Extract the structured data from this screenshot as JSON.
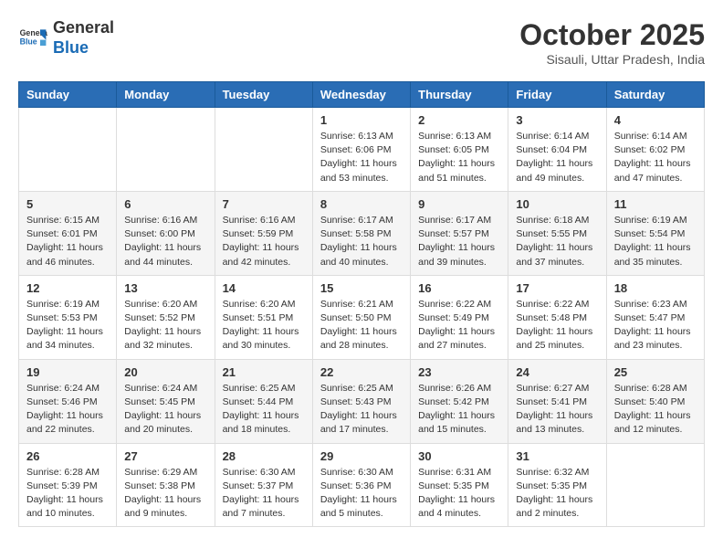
{
  "header": {
    "logo_general": "General",
    "logo_blue": "Blue",
    "month": "October 2025",
    "location": "Sisauli, Uttar Pradesh, India"
  },
  "weekdays": [
    "Sunday",
    "Monday",
    "Tuesday",
    "Wednesday",
    "Thursday",
    "Friday",
    "Saturday"
  ],
  "weeks": [
    [
      {
        "day": "",
        "info": ""
      },
      {
        "day": "",
        "info": ""
      },
      {
        "day": "",
        "info": ""
      },
      {
        "day": "1",
        "info": "Sunrise: 6:13 AM\nSunset: 6:06 PM\nDaylight: 11 hours\nand 53 minutes."
      },
      {
        "day": "2",
        "info": "Sunrise: 6:13 AM\nSunset: 6:05 PM\nDaylight: 11 hours\nand 51 minutes."
      },
      {
        "day": "3",
        "info": "Sunrise: 6:14 AM\nSunset: 6:04 PM\nDaylight: 11 hours\nand 49 minutes."
      },
      {
        "day": "4",
        "info": "Sunrise: 6:14 AM\nSunset: 6:02 PM\nDaylight: 11 hours\nand 47 minutes."
      }
    ],
    [
      {
        "day": "5",
        "info": "Sunrise: 6:15 AM\nSunset: 6:01 PM\nDaylight: 11 hours\nand 46 minutes."
      },
      {
        "day": "6",
        "info": "Sunrise: 6:16 AM\nSunset: 6:00 PM\nDaylight: 11 hours\nand 44 minutes."
      },
      {
        "day": "7",
        "info": "Sunrise: 6:16 AM\nSunset: 5:59 PM\nDaylight: 11 hours\nand 42 minutes."
      },
      {
        "day": "8",
        "info": "Sunrise: 6:17 AM\nSunset: 5:58 PM\nDaylight: 11 hours\nand 40 minutes."
      },
      {
        "day": "9",
        "info": "Sunrise: 6:17 AM\nSunset: 5:57 PM\nDaylight: 11 hours\nand 39 minutes."
      },
      {
        "day": "10",
        "info": "Sunrise: 6:18 AM\nSunset: 5:55 PM\nDaylight: 11 hours\nand 37 minutes."
      },
      {
        "day": "11",
        "info": "Sunrise: 6:19 AM\nSunset: 5:54 PM\nDaylight: 11 hours\nand 35 minutes."
      }
    ],
    [
      {
        "day": "12",
        "info": "Sunrise: 6:19 AM\nSunset: 5:53 PM\nDaylight: 11 hours\nand 34 minutes."
      },
      {
        "day": "13",
        "info": "Sunrise: 6:20 AM\nSunset: 5:52 PM\nDaylight: 11 hours\nand 32 minutes."
      },
      {
        "day": "14",
        "info": "Sunrise: 6:20 AM\nSunset: 5:51 PM\nDaylight: 11 hours\nand 30 minutes."
      },
      {
        "day": "15",
        "info": "Sunrise: 6:21 AM\nSunset: 5:50 PM\nDaylight: 11 hours\nand 28 minutes."
      },
      {
        "day": "16",
        "info": "Sunrise: 6:22 AM\nSunset: 5:49 PM\nDaylight: 11 hours\nand 27 minutes."
      },
      {
        "day": "17",
        "info": "Sunrise: 6:22 AM\nSunset: 5:48 PM\nDaylight: 11 hours\nand 25 minutes."
      },
      {
        "day": "18",
        "info": "Sunrise: 6:23 AM\nSunset: 5:47 PM\nDaylight: 11 hours\nand 23 minutes."
      }
    ],
    [
      {
        "day": "19",
        "info": "Sunrise: 6:24 AM\nSunset: 5:46 PM\nDaylight: 11 hours\nand 22 minutes."
      },
      {
        "day": "20",
        "info": "Sunrise: 6:24 AM\nSunset: 5:45 PM\nDaylight: 11 hours\nand 20 minutes."
      },
      {
        "day": "21",
        "info": "Sunrise: 6:25 AM\nSunset: 5:44 PM\nDaylight: 11 hours\nand 18 minutes."
      },
      {
        "day": "22",
        "info": "Sunrise: 6:25 AM\nSunset: 5:43 PM\nDaylight: 11 hours\nand 17 minutes."
      },
      {
        "day": "23",
        "info": "Sunrise: 6:26 AM\nSunset: 5:42 PM\nDaylight: 11 hours\nand 15 minutes."
      },
      {
        "day": "24",
        "info": "Sunrise: 6:27 AM\nSunset: 5:41 PM\nDaylight: 11 hours\nand 13 minutes."
      },
      {
        "day": "25",
        "info": "Sunrise: 6:28 AM\nSunset: 5:40 PM\nDaylight: 11 hours\nand 12 minutes."
      }
    ],
    [
      {
        "day": "26",
        "info": "Sunrise: 6:28 AM\nSunset: 5:39 PM\nDaylight: 11 hours\nand 10 minutes."
      },
      {
        "day": "27",
        "info": "Sunrise: 6:29 AM\nSunset: 5:38 PM\nDaylight: 11 hours\nand 9 minutes."
      },
      {
        "day": "28",
        "info": "Sunrise: 6:30 AM\nSunset: 5:37 PM\nDaylight: 11 hours\nand 7 minutes."
      },
      {
        "day": "29",
        "info": "Sunrise: 6:30 AM\nSunset: 5:36 PM\nDaylight: 11 hours\nand 5 minutes."
      },
      {
        "day": "30",
        "info": "Sunrise: 6:31 AM\nSunset: 5:35 PM\nDaylight: 11 hours\nand 4 minutes."
      },
      {
        "day": "31",
        "info": "Sunrise: 6:32 AM\nSunset: 5:35 PM\nDaylight: 11 hours\nand 2 minutes."
      },
      {
        "day": "",
        "info": ""
      }
    ]
  ]
}
